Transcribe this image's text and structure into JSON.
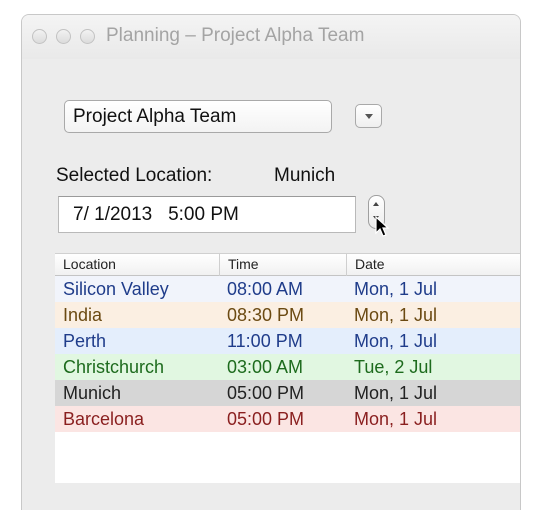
{
  "window": {
    "title": "Planning – Project Alpha Team"
  },
  "team_selector": {
    "value": "Project Alpha Team",
    "arrow_icon": "chevron-down-icon"
  },
  "selected_location": {
    "label": "Selected Location:",
    "value": "Munich"
  },
  "datetime": {
    "value": "7/ 1/2013   5:00 PM"
  },
  "table": {
    "headers": [
      "Location",
      "Time",
      "Date"
    ],
    "rows": [
      {
        "location": "Silicon Valley",
        "time": "08:00 AM",
        "date": "Mon, 1 Jul",
        "bg": "#f1f4fb",
        "fg": "#1f3c8a"
      },
      {
        "location": "India",
        "time": "08:30 PM",
        "date": "Mon, 1 Jul",
        "bg": "#fbefe2",
        "fg": "#6b4a12"
      },
      {
        "location": "Perth",
        "time": "11:00 PM",
        "date": "Mon, 1 Jul",
        "bg": "#e4eefc",
        "fg": "#1f3c8a"
      },
      {
        "location": "Christchurch",
        "time": "03:00 AM",
        "date": "Tue, 2 Jul",
        "bg": "#e1f7e1",
        "fg": "#1d6b1d"
      },
      {
        "location": "Munich",
        "time": "05:00 PM",
        "date": "Mon, 1 Jul",
        "bg": "#d6d6d6",
        "fg": "#222222"
      },
      {
        "location": "Barcelona",
        "time": "05:00 PM",
        "date": "Mon, 1 Jul",
        "bg": "#fbe5e3",
        "fg": "#8a1f1f"
      }
    ]
  }
}
